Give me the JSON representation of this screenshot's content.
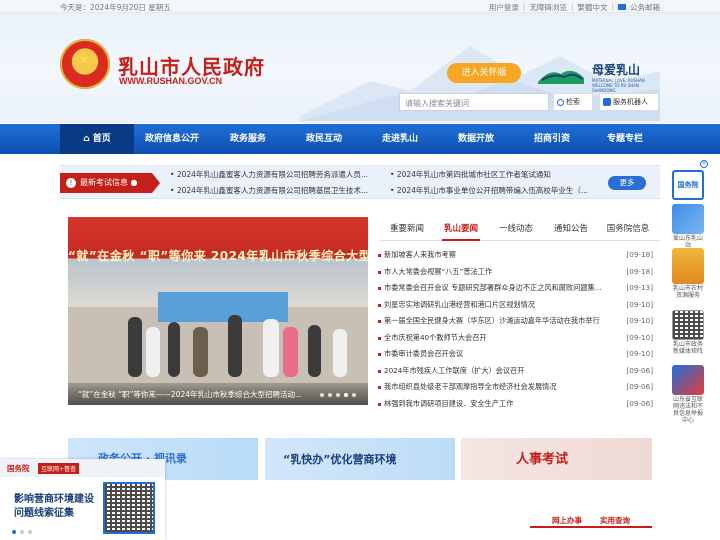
{
  "topbar": {
    "date": "今天是：2024年9月20日 星期五",
    "links": [
      "用户登录",
      "无障碍浏览",
      "繁體中文",
      "公务邮箱"
    ]
  },
  "header": {
    "title": "乳山市人民政府",
    "url": "WWW.RUSHAN.GOV.CN",
    "care_button": "进入关怀版",
    "brand_title": "母爱乳山",
    "brand_sub": "MATERNAL LOVE, RUSHAN WELCOME TO RU SHAN SHANDONG",
    "search_placeholder": "请输入搜索关键词",
    "search_button": "检索",
    "robot_button": "服务机器人"
  },
  "nav": {
    "items": [
      "首页",
      "政府信息公开",
      "政务服务",
      "政民互动",
      "走进乳山",
      "数据开放",
      "招商引资",
      "专题专栏"
    ]
  },
  "exam": {
    "label": "最新考试信息",
    "items": [
      "2024年乳山鑫蜜客人力资源有限公司招聘劳务派遣人员...",
      "2024年乳山市第四批城市社区工作者笔试通知",
      "2024年乳山鑫蜜客人力资源有限公司招聘基层卫生技术...",
      "2024年乳山市事业单位公开招聘带编入伍高校毕业生（..."
    ],
    "more": "更多"
  },
  "photo": {
    "banner": "“就”在金秋  “职”等你来  2024年乳山市秋季综合大型招聘会",
    "caption": "“就”在金秋 “职”等你来——2024年乳山市秋季综合大型招聘活动..."
  },
  "tabs": [
    "重要新闻",
    "乳山要闻",
    "一线动态",
    "通知公告",
    "国务院信息"
  ],
  "news": [
    {
      "title": "新加坡客人来我市考察",
      "date": "[09-18]"
    },
    {
      "title": "市人大常委会视察“八五”普法工作",
      "date": "[09-18]"
    },
    {
      "title": "市委常委会召开会议 专题研究部署群众身边不正之风和腐败问题集...",
      "date": "[09-13]"
    },
    {
      "title": "刘星忠实地调研乳山港经营和港口片区规划情况",
      "date": "[09-10]"
    },
    {
      "title": "第一届全国全民健身大赛（华东区）沙滩运动嘉年华活动在我市举行",
      "date": "[09-10]"
    },
    {
      "title": "全市庆祝第40个教师节大会召开",
      "date": "[09-10]"
    },
    {
      "title": "市委审计委员会召开会议",
      "date": "[09-10]"
    },
    {
      "title": "2024年市残疾人工作联席（扩大）会议召开",
      "date": "[09-06]"
    },
    {
      "title": "我市组织县处级老干部观摩指导全市经济社会发展情况",
      "date": "[09-06]"
    },
    {
      "title": "林强到我市调研项目建设、安全生产工作",
      "date": "[09-06]"
    }
  ],
  "sidebar": {
    "items": [
      "国务院",
      "爱山东乳山站",
      "乳山市农村资源服务",
      "乳山市政务新媒体矩阵",
      "山东省互联网违法和不良信息举报中心"
    ]
  },
  "banners": [
    "政务公开 · 视讯录",
    "“乳快办”优化营商环境",
    "人事考试"
  ],
  "bottom_bar": [
    "网上办事",
    "实用查询"
  ],
  "float_panel": {
    "gwy": "国务院",
    "tag": "互联网+督查",
    "line1": "影响营商环境建设",
    "line2": "问题线索征集"
  },
  "colors": {
    "brand_red": "#c4201a",
    "nav_blue": "#1458c2",
    "accent_orange": "#f5a623"
  }
}
